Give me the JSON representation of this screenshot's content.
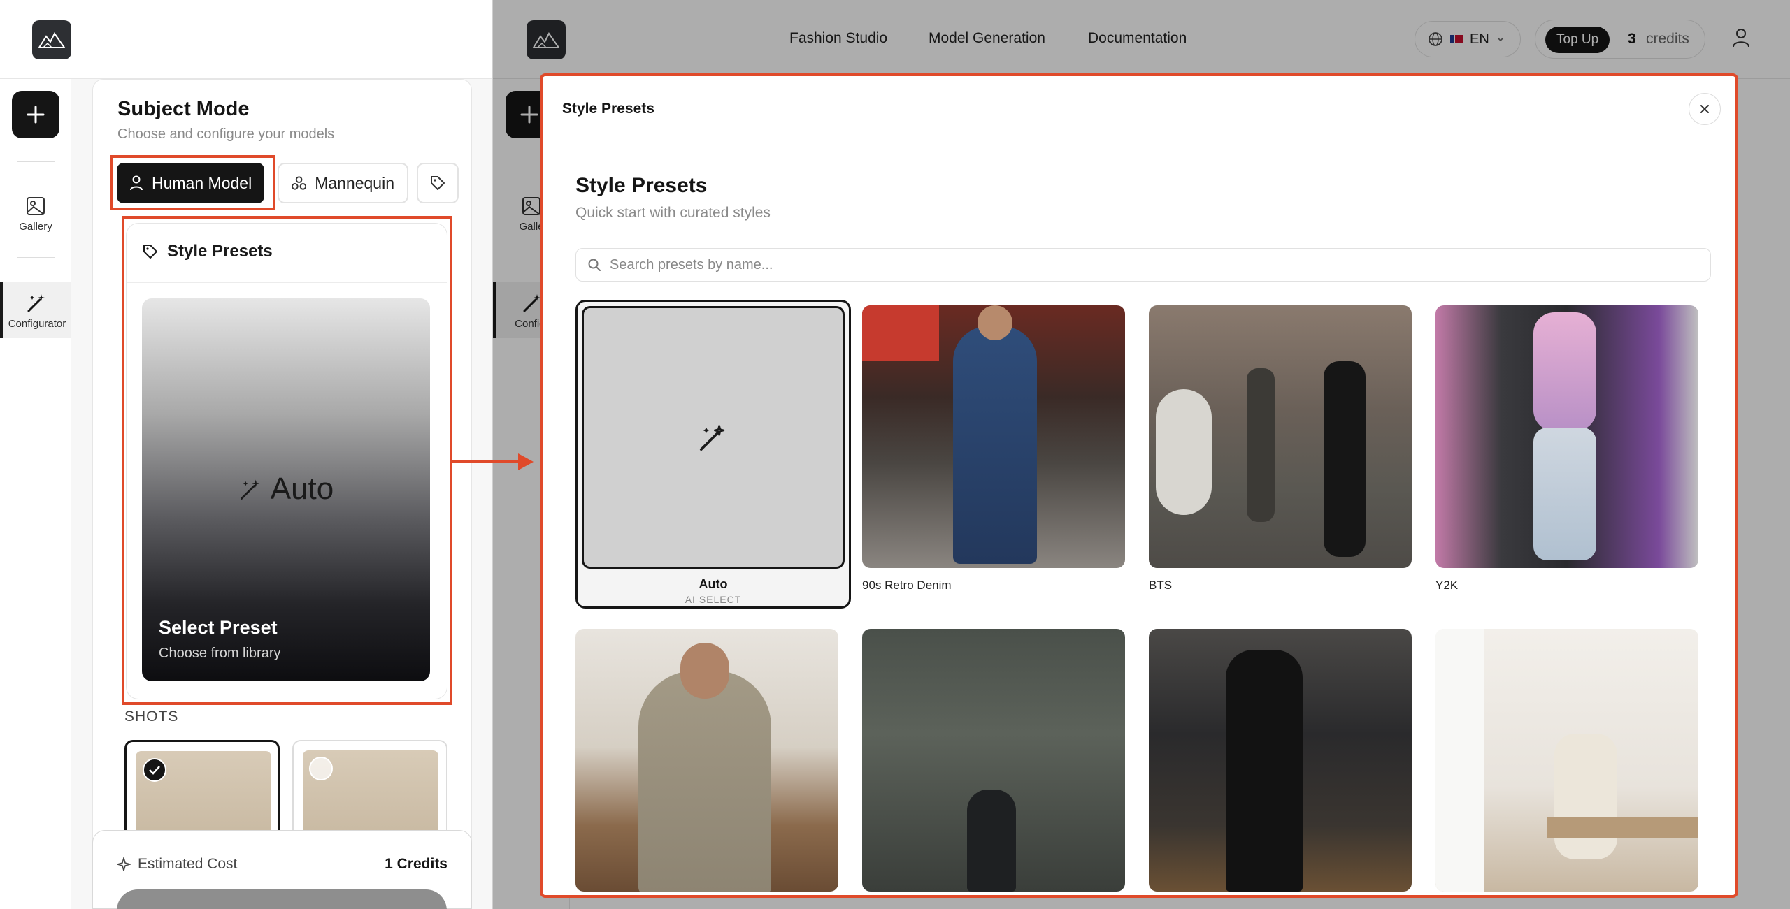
{
  "left_panel": {
    "rail": {
      "items": [
        {
          "label": "Gallery"
        },
        {
          "label": "Configurator"
        }
      ]
    },
    "subject_mode": {
      "title": "Subject Mode",
      "subtitle": "Choose and configure your models",
      "modes": [
        {
          "label": "Human Model",
          "selected": true
        },
        {
          "label": "Mannequin",
          "selected": false
        },
        {
          "label": ""
        }
      ]
    },
    "style_presets": {
      "header": "Style Presets",
      "auto_label": "Auto",
      "select_label": "Select Preset",
      "select_sub": "Choose from library"
    },
    "shots_label": "SHOTS",
    "cost": {
      "label": "Estimated Cost",
      "value": "1 Credits"
    }
  },
  "header": {
    "nav": [
      "Fashion Studio",
      "Model Generation",
      "Documentation"
    ],
    "language": "EN",
    "topup_label": "Top Up",
    "credits_count": "3",
    "credits_word": "credits"
  },
  "right_rail": {
    "items": [
      {
        "label": "Galle"
      },
      {
        "label": "Configu"
      }
    ]
  },
  "modal": {
    "header_title": "Style Presets",
    "title": "Style Presets",
    "subtitle": "Quick start with curated styles",
    "search_placeholder": "Search presets by name...",
    "presets": [
      {
        "name": "Auto",
        "tag": "AI SELECT",
        "selected": true
      },
      {
        "name": "90s Retro Denim"
      },
      {
        "name": "BTS"
      },
      {
        "name": "Y2K"
      },
      {
        "name": ""
      },
      {
        "name": ""
      },
      {
        "name": ""
      },
      {
        "name": ""
      }
    ]
  },
  "colors": {
    "highlight": "#e04a2a",
    "dark": "#151515"
  },
  "icons": [
    "logo-icon",
    "plus-icon",
    "gallery-icon",
    "magic-wand-icon",
    "user-icon",
    "mannequin-icon",
    "tag-icon",
    "globe-icon",
    "flag-icon",
    "chevron-down-icon",
    "close-icon",
    "search-icon",
    "sparkle-icon",
    "check-icon"
  ]
}
